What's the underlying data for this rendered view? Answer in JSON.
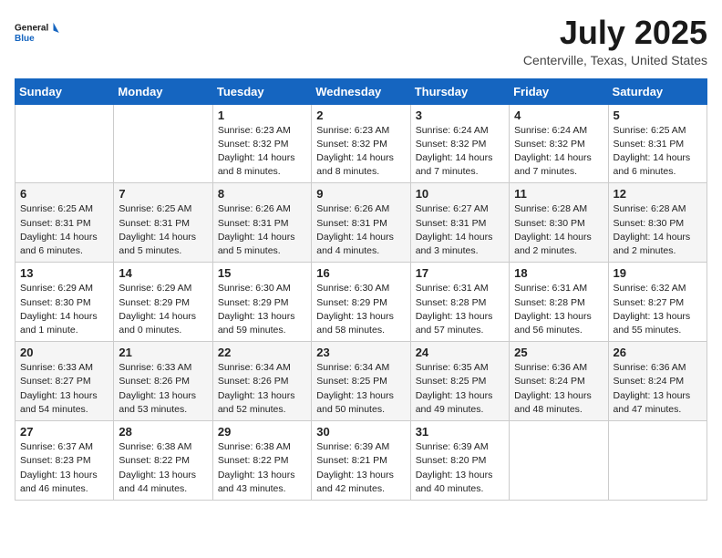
{
  "header": {
    "logo_line1": "General",
    "logo_line2": "Blue",
    "month": "July 2025",
    "location": "Centerville, Texas, United States"
  },
  "weekdays": [
    "Sunday",
    "Monday",
    "Tuesday",
    "Wednesday",
    "Thursday",
    "Friday",
    "Saturday"
  ],
  "weeks": [
    [
      {
        "day": "",
        "info": ""
      },
      {
        "day": "",
        "info": ""
      },
      {
        "day": "1",
        "info": "Sunrise: 6:23 AM\nSunset: 8:32 PM\nDaylight: 14 hours\nand 8 minutes."
      },
      {
        "day": "2",
        "info": "Sunrise: 6:23 AM\nSunset: 8:32 PM\nDaylight: 14 hours\nand 8 minutes."
      },
      {
        "day": "3",
        "info": "Sunrise: 6:24 AM\nSunset: 8:32 PM\nDaylight: 14 hours\nand 7 minutes."
      },
      {
        "day": "4",
        "info": "Sunrise: 6:24 AM\nSunset: 8:32 PM\nDaylight: 14 hours\nand 7 minutes."
      },
      {
        "day": "5",
        "info": "Sunrise: 6:25 AM\nSunset: 8:31 PM\nDaylight: 14 hours\nand 6 minutes."
      }
    ],
    [
      {
        "day": "6",
        "info": "Sunrise: 6:25 AM\nSunset: 8:31 PM\nDaylight: 14 hours\nand 6 minutes."
      },
      {
        "day": "7",
        "info": "Sunrise: 6:25 AM\nSunset: 8:31 PM\nDaylight: 14 hours\nand 5 minutes."
      },
      {
        "day": "8",
        "info": "Sunrise: 6:26 AM\nSunset: 8:31 PM\nDaylight: 14 hours\nand 5 minutes."
      },
      {
        "day": "9",
        "info": "Sunrise: 6:26 AM\nSunset: 8:31 PM\nDaylight: 14 hours\nand 4 minutes."
      },
      {
        "day": "10",
        "info": "Sunrise: 6:27 AM\nSunset: 8:31 PM\nDaylight: 14 hours\nand 3 minutes."
      },
      {
        "day": "11",
        "info": "Sunrise: 6:28 AM\nSunset: 8:30 PM\nDaylight: 14 hours\nand 2 minutes."
      },
      {
        "day": "12",
        "info": "Sunrise: 6:28 AM\nSunset: 8:30 PM\nDaylight: 14 hours\nand 2 minutes."
      }
    ],
    [
      {
        "day": "13",
        "info": "Sunrise: 6:29 AM\nSunset: 8:30 PM\nDaylight: 14 hours\nand 1 minute."
      },
      {
        "day": "14",
        "info": "Sunrise: 6:29 AM\nSunset: 8:29 PM\nDaylight: 14 hours\nand 0 minutes."
      },
      {
        "day": "15",
        "info": "Sunrise: 6:30 AM\nSunset: 8:29 PM\nDaylight: 13 hours\nand 59 minutes."
      },
      {
        "day": "16",
        "info": "Sunrise: 6:30 AM\nSunset: 8:29 PM\nDaylight: 13 hours\nand 58 minutes."
      },
      {
        "day": "17",
        "info": "Sunrise: 6:31 AM\nSunset: 8:28 PM\nDaylight: 13 hours\nand 57 minutes."
      },
      {
        "day": "18",
        "info": "Sunrise: 6:31 AM\nSunset: 8:28 PM\nDaylight: 13 hours\nand 56 minutes."
      },
      {
        "day": "19",
        "info": "Sunrise: 6:32 AM\nSunset: 8:27 PM\nDaylight: 13 hours\nand 55 minutes."
      }
    ],
    [
      {
        "day": "20",
        "info": "Sunrise: 6:33 AM\nSunset: 8:27 PM\nDaylight: 13 hours\nand 54 minutes."
      },
      {
        "day": "21",
        "info": "Sunrise: 6:33 AM\nSunset: 8:26 PM\nDaylight: 13 hours\nand 53 minutes."
      },
      {
        "day": "22",
        "info": "Sunrise: 6:34 AM\nSunset: 8:26 PM\nDaylight: 13 hours\nand 52 minutes."
      },
      {
        "day": "23",
        "info": "Sunrise: 6:34 AM\nSunset: 8:25 PM\nDaylight: 13 hours\nand 50 minutes."
      },
      {
        "day": "24",
        "info": "Sunrise: 6:35 AM\nSunset: 8:25 PM\nDaylight: 13 hours\nand 49 minutes."
      },
      {
        "day": "25",
        "info": "Sunrise: 6:36 AM\nSunset: 8:24 PM\nDaylight: 13 hours\nand 48 minutes."
      },
      {
        "day": "26",
        "info": "Sunrise: 6:36 AM\nSunset: 8:24 PM\nDaylight: 13 hours\nand 47 minutes."
      }
    ],
    [
      {
        "day": "27",
        "info": "Sunrise: 6:37 AM\nSunset: 8:23 PM\nDaylight: 13 hours\nand 46 minutes."
      },
      {
        "day": "28",
        "info": "Sunrise: 6:38 AM\nSunset: 8:22 PM\nDaylight: 13 hours\nand 44 minutes."
      },
      {
        "day": "29",
        "info": "Sunrise: 6:38 AM\nSunset: 8:22 PM\nDaylight: 13 hours\nand 43 minutes."
      },
      {
        "day": "30",
        "info": "Sunrise: 6:39 AM\nSunset: 8:21 PM\nDaylight: 13 hours\nand 42 minutes."
      },
      {
        "day": "31",
        "info": "Sunrise: 6:39 AM\nSunset: 8:20 PM\nDaylight: 13 hours\nand 40 minutes."
      },
      {
        "day": "",
        "info": ""
      },
      {
        "day": "",
        "info": ""
      }
    ]
  ]
}
